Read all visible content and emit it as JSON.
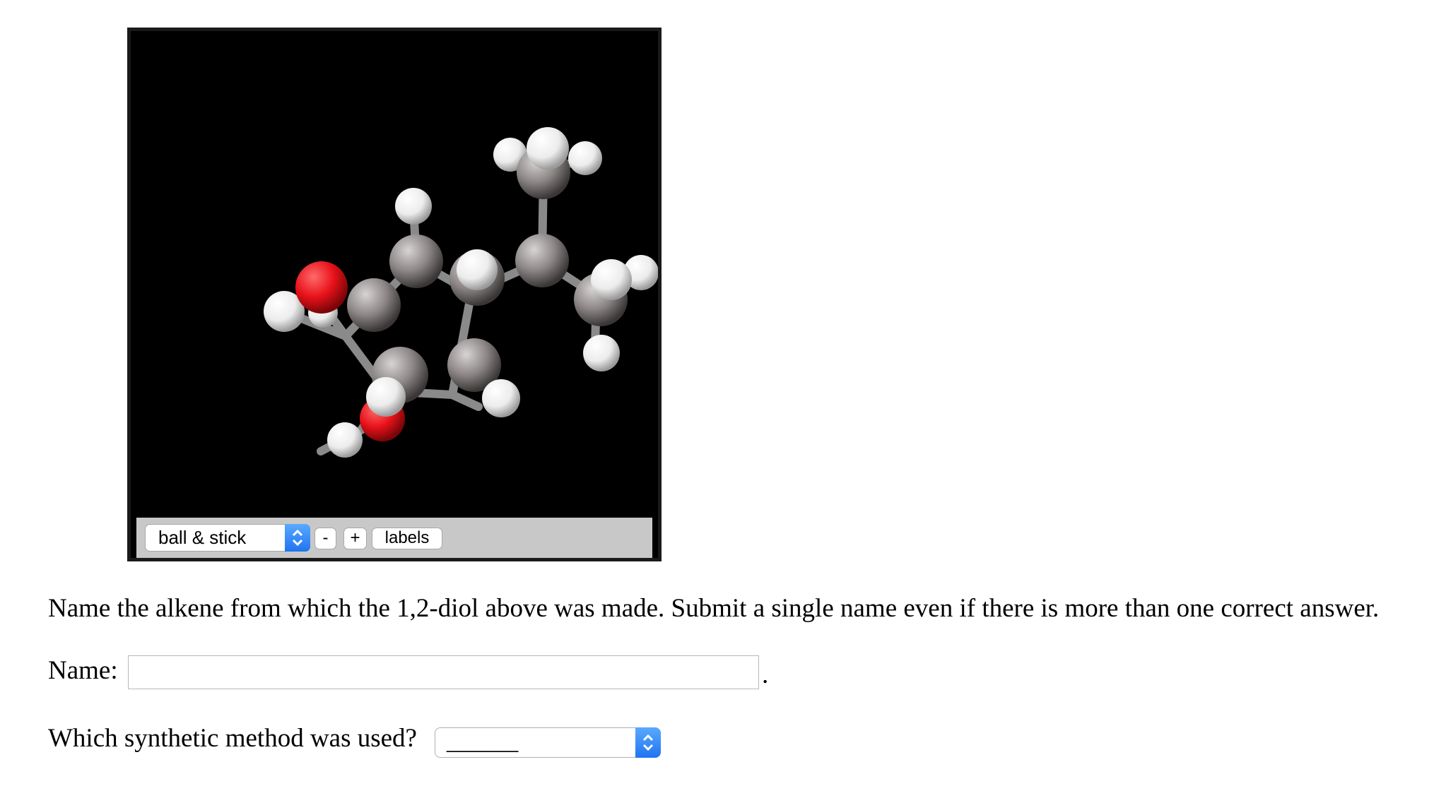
{
  "viewer": {
    "style_options_selected": "ball & stick",
    "zoom_out_label": "-",
    "zoom_in_label": "+",
    "labels_label": "labels",
    "colors": {
      "background": "#000000",
      "carbon": "#8c8686",
      "hydrogen": "#f2f2f2",
      "oxygen": "#e8121a",
      "bond": "#8a8a8a",
      "control_bar": "#c8c8c8",
      "select_arrow": "#2a7ef5"
    }
  },
  "question": {
    "text": "Name the alkene from which the 1,2-diol above was made. Submit a single name even if there is more than one correct answer."
  },
  "name_field": {
    "label": "Name:",
    "value": "",
    "trailing": "."
  },
  "method_field": {
    "label": "Which synthetic method was used?",
    "selected": "_______"
  }
}
